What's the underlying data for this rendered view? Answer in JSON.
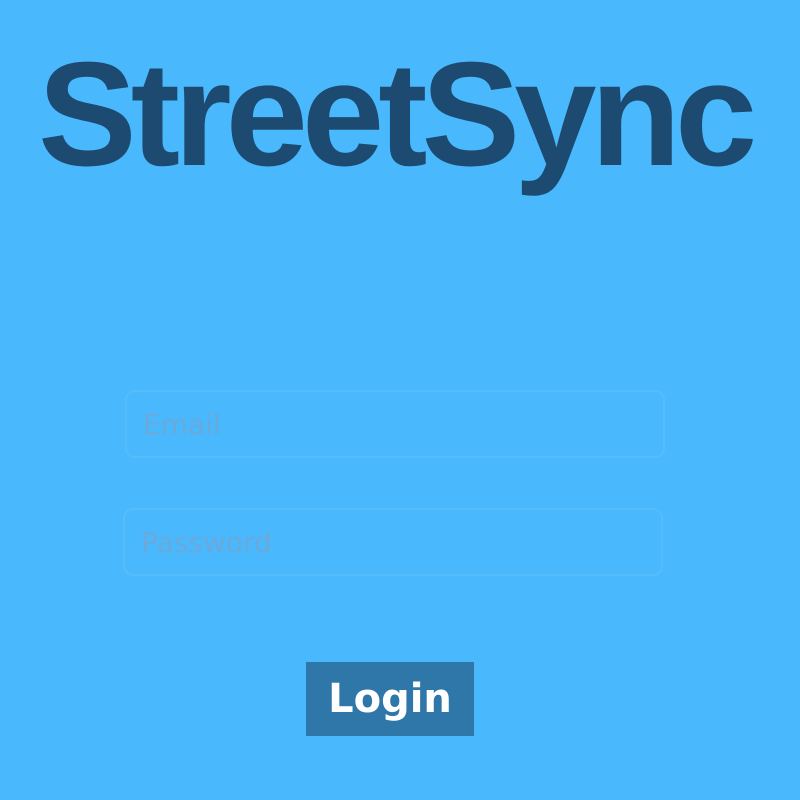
{
  "app": {
    "title": "StreetSync"
  },
  "login_form": {
    "email_placeholder": "Email",
    "email_value": "",
    "password_placeholder": "Password",
    "password_value": "",
    "submit_label": "Login"
  },
  "colors": {
    "background": "#4ab8fc",
    "title": "#1d4a70",
    "button": "#2e77a8",
    "button_text": "#ffffff"
  }
}
